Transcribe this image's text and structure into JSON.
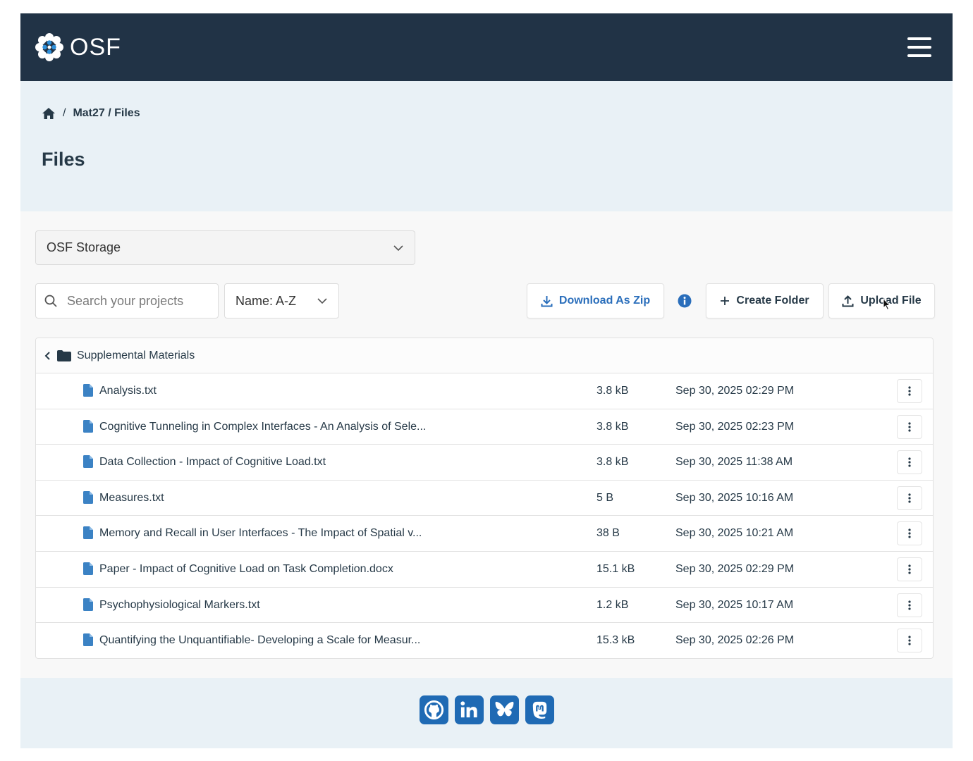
{
  "brand": {
    "name": "OSF",
    "color": "#213346"
  },
  "breadcrumb": {
    "separator": "/",
    "path": "Mat27 / Files"
  },
  "page": {
    "title": "Files"
  },
  "storage": {
    "selected": "OSF Storage"
  },
  "search": {
    "placeholder": "Search your projects",
    "value": ""
  },
  "sort": {
    "selected": "Name: A-Z"
  },
  "toolbar": {
    "download_zip_label": "Download As Zip",
    "create_folder_label": "Create Folder",
    "upload_file_label": "Upload File"
  },
  "folder": {
    "name": "Supplemental Materials"
  },
  "files": [
    {
      "name": "Analysis.txt",
      "size": "3.8 kB",
      "date": "Sep 30, 2025 02:29 PM"
    },
    {
      "name": "Cognitive Tunneling in Complex Interfaces - An Analysis of Sele...",
      "size": "3.8 kB",
      "date": "Sep 30, 2025 02:23 PM"
    },
    {
      "name": "Data Collection - Impact of Cognitive Load.txt",
      "size": "3.8 kB",
      "date": "Sep 30, 2025 11:38 AM"
    },
    {
      "name": "Measures.txt",
      "size": "5 B",
      "date": "Sep 30, 2025 10:16 AM"
    },
    {
      "name": "Memory and Recall in User Interfaces - The Impact of Spatial v...",
      "size": "38 B",
      "date": "Sep 30, 2025 10:21 AM"
    },
    {
      "name": "Paper - Impact of Cognitive Load on Task Completion.docx",
      "size": "15.1 kB",
      "date": "Sep 30, 2025 02:29 PM"
    },
    {
      "name": "Psychophysiological Markers.txt",
      "size": "1.2 kB",
      "date": "Sep 30, 2025 10:17 AM"
    },
    {
      "name": "Quantifying the Unquantifiable- Developing a Scale for Measur...",
      "size": "15.3 kB",
      "date": "Sep 30, 2025 02:26 PM"
    }
  ],
  "footer": {
    "social_icons": [
      "github-icon",
      "linkedin-icon",
      "bluesky-icon",
      "mastodon-icon"
    ]
  },
  "colors": {
    "accent": "#2a6ebb",
    "hero_bg": "#e9f1f6",
    "file_icon": "#3b82c4",
    "social_bg": "#1f6ab4"
  }
}
